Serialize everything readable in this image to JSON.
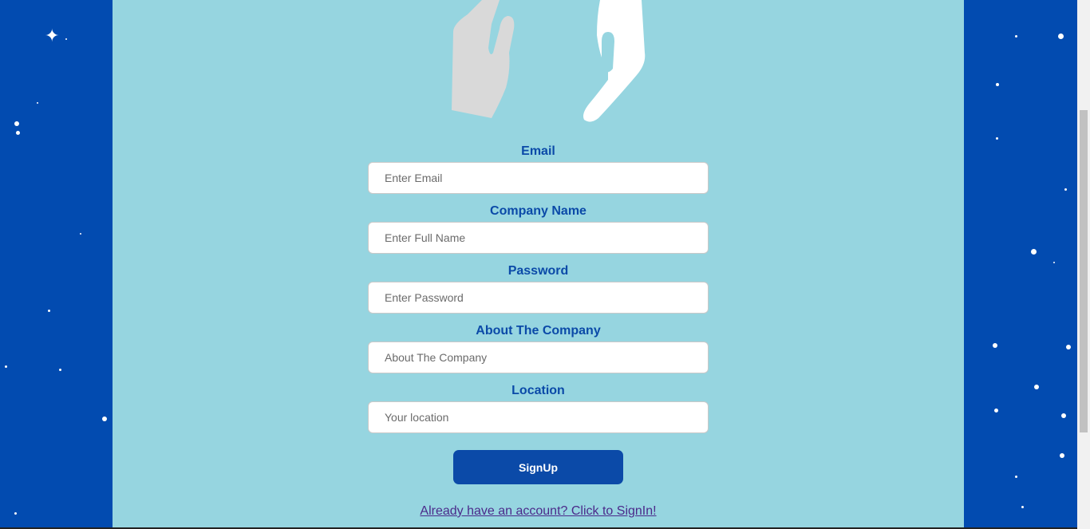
{
  "form": {
    "fields": [
      {
        "label": "Email",
        "placeholder": "Enter Email",
        "type": "email"
      },
      {
        "label": "Company Name",
        "placeholder": "Enter Full Name",
        "type": "text"
      },
      {
        "label": "Password",
        "placeholder": "Enter Password",
        "type": "password"
      },
      {
        "label": "About The Company",
        "placeholder": "About The Company",
        "type": "text"
      },
      {
        "label": "Location",
        "placeholder": "Your location",
        "type": "text"
      }
    ],
    "submit_label": "SignUp",
    "signin_link": "Already have an account? Click to SignIn!"
  },
  "colors": {
    "background": "#004aad",
    "panel": "#96d5e0",
    "accent": "#0b4aa8",
    "link": "#4b2a8a"
  },
  "icons": {
    "hero": "reaching-hands-illustration"
  }
}
